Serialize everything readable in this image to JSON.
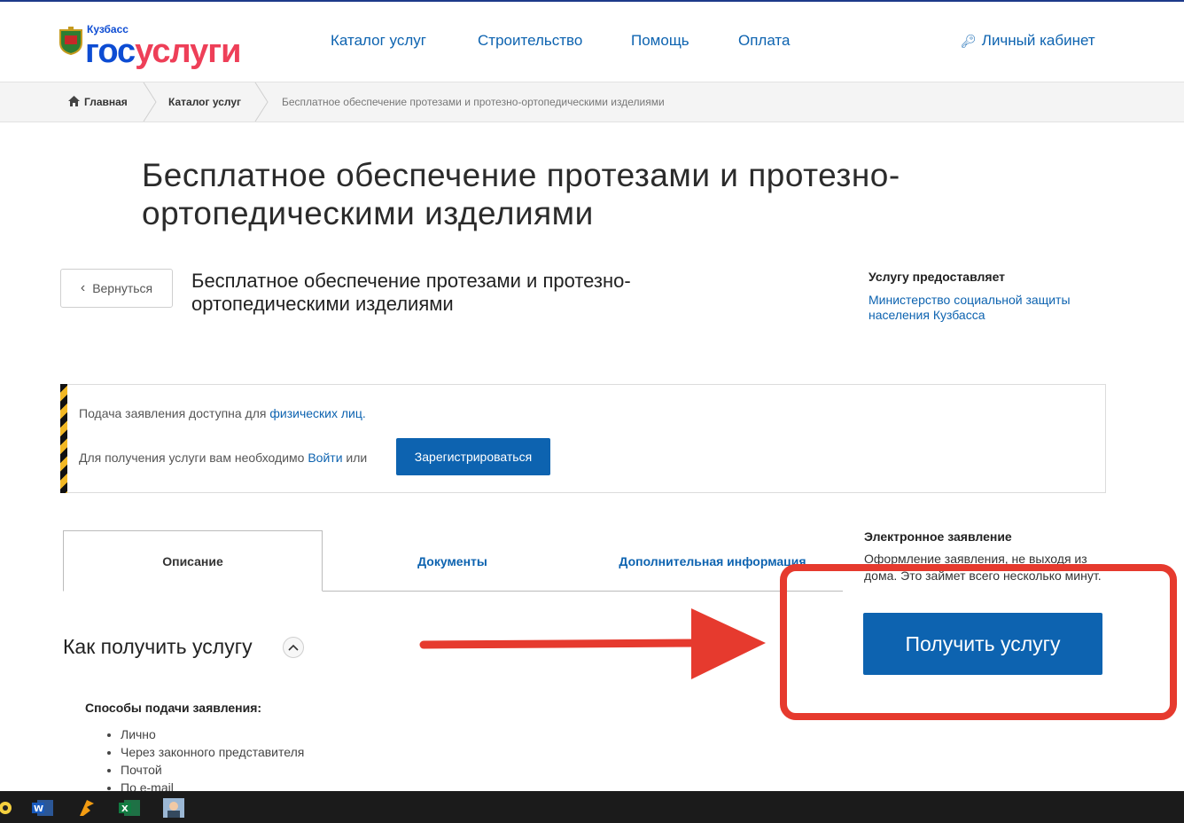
{
  "header": {
    "logo_region": "Кузбасс",
    "logo_brand_part1": "гос",
    "logo_brand_part2": "услуги",
    "nav": [
      "Каталог услуг",
      "Строительство",
      "Помощь",
      "Оплата"
    ],
    "cabinet_label": "Личный кабинет"
  },
  "breadcrumb": {
    "home": "Главная",
    "catalog": "Каталог услуг",
    "current": "Бесплатное обеспечение протезами и протезно-ортопедическими изделиями"
  },
  "page_title": "Бесплатное обеспечение протезами и протезно-ортопедическими изделиями",
  "back_label": "Вернуться",
  "service_title": "Бесплатное обеспечение протезами и протезно-ортопедическими изделиями",
  "provider": {
    "label": "Услугу предоставляет",
    "name": "Министерство социальной защиты населения Кузбасса"
  },
  "notice": {
    "line1_text": "Подача заявления доступна для ",
    "line1_link": "физических лиц.",
    "line2_text": "Для получения услуги вам необходимо ",
    "line2_link": "Войти",
    "line2_or": " или",
    "register_label": "Зарегистрироваться"
  },
  "tabs": [
    "Описание",
    "Документы",
    "Дополнительная информация"
  ],
  "electronic": {
    "title": "Электронное заявление",
    "description": "Оформление заявления, не выходя из дома. Это займет всего несколько минут.",
    "button_label": "Получить услугу"
  },
  "how": {
    "title": "Как получить услугу",
    "methods_label": "Способы подачи заявления:",
    "methods": [
      "Лично",
      "Через законного представителя",
      "Почтой",
      "По e-mail"
    ]
  },
  "colors": {
    "link": "#0d63b0",
    "brand_blue": "#0d4cd3",
    "brand_red": "#ee3f58",
    "annotation_red": "#e63a2e"
  },
  "taskbar_icons": [
    "app-icon",
    "word-icon",
    "browser-icon",
    "excel-icon",
    "user-app-icon"
  ]
}
